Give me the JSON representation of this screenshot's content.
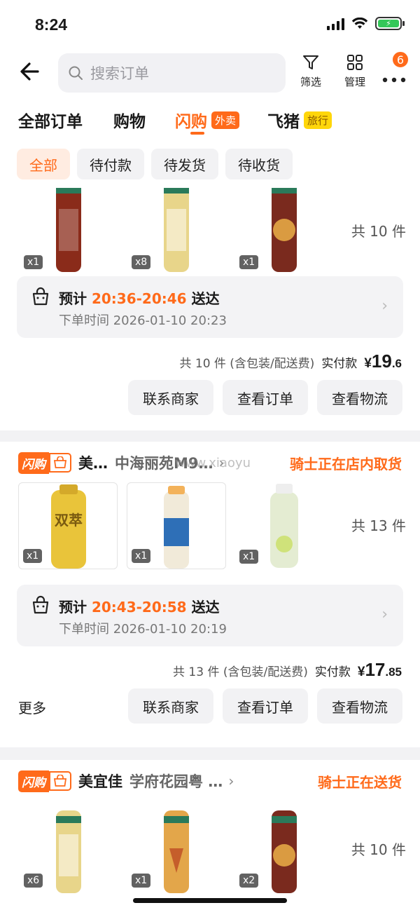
{
  "status_bar": {
    "time": "8:24"
  },
  "search": {
    "placeholder": "搜索订单"
  },
  "toolbar": {
    "filter_label": "筛选",
    "manage_label": "管理",
    "more_badge": "6"
  },
  "tabs": [
    {
      "label": "全部订单",
      "tag": ""
    },
    {
      "label": "购物",
      "tag": ""
    },
    {
      "label": "闪购",
      "tag": "外卖"
    },
    {
      "label": "飞猪",
      "tag": "旅行"
    }
  ],
  "filters": [
    "全部",
    "待付款",
    "待发货",
    "待收货"
  ],
  "orders": [
    {
      "products": [
        {
          "qty": "x1",
          "color": "#8a2b1a"
        },
        {
          "qty": "x8",
          "color": "#e8d58a"
        },
        {
          "qty": "x1",
          "color": "#7a2a1e"
        }
      ],
      "count": "共 10 件",
      "eta_label": "预计",
      "eta_time": "20:36-20:46",
      "eta_suffix": "送达",
      "order_time": "下单时间 2026-01-10 20:23",
      "summary": "共 10 件 (含包装/配送费)",
      "paid_label": "实付款",
      "price_int": "19",
      "price_dec": ".6",
      "buttons": [
        "联系商家",
        "查看订单",
        "查看物流"
      ]
    },
    {
      "badge": "闪购",
      "store": "美…",
      "branch": "中海丽苑M9…",
      "rider_status": "骑士正在店内取货",
      "products": [
        {
          "qty": "x1",
          "color": "#e9c43a"
        },
        {
          "qty": "x1",
          "color": "#f1ead9"
        },
        {
          "qty": "x1",
          "color": "#e4ecd2"
        }
      ],
      "count": "共 13 件",
      "eta_label": "预计",
      "eta_time": "20:43-20:58",
      "eta_suffix": "送达",
      "order_time": "下单时间 2026-01-10 20:19",
      "summary": "共 13 件 (含包装/配送费)",
      "paid_label": "实付款",
      "price_int": "17",
      "price_dec": ".85",
      "more": "更多",
      "buttons": [
        "联系商家",
        "查看订单",
        "查看物流"
      ]
    },
    {
      "badge": "闪购",
      "store": "美宜佳",
      "branch": "学府花园粤 …",
      "rider_status": "骑士正在送货",
      "products": [
        {
          "qty": "x6",
          "color": "#e8d58a"
        },
        {
          "qty": "x1",
          "color": "#e3a64a"
        },
        {
          "qty": "x2",
          "color": "#7a2a1e"
        }
      ],
      "count": "共 10 件"
    }
  ],
  "watermark": "www.xiaoyu"
}
